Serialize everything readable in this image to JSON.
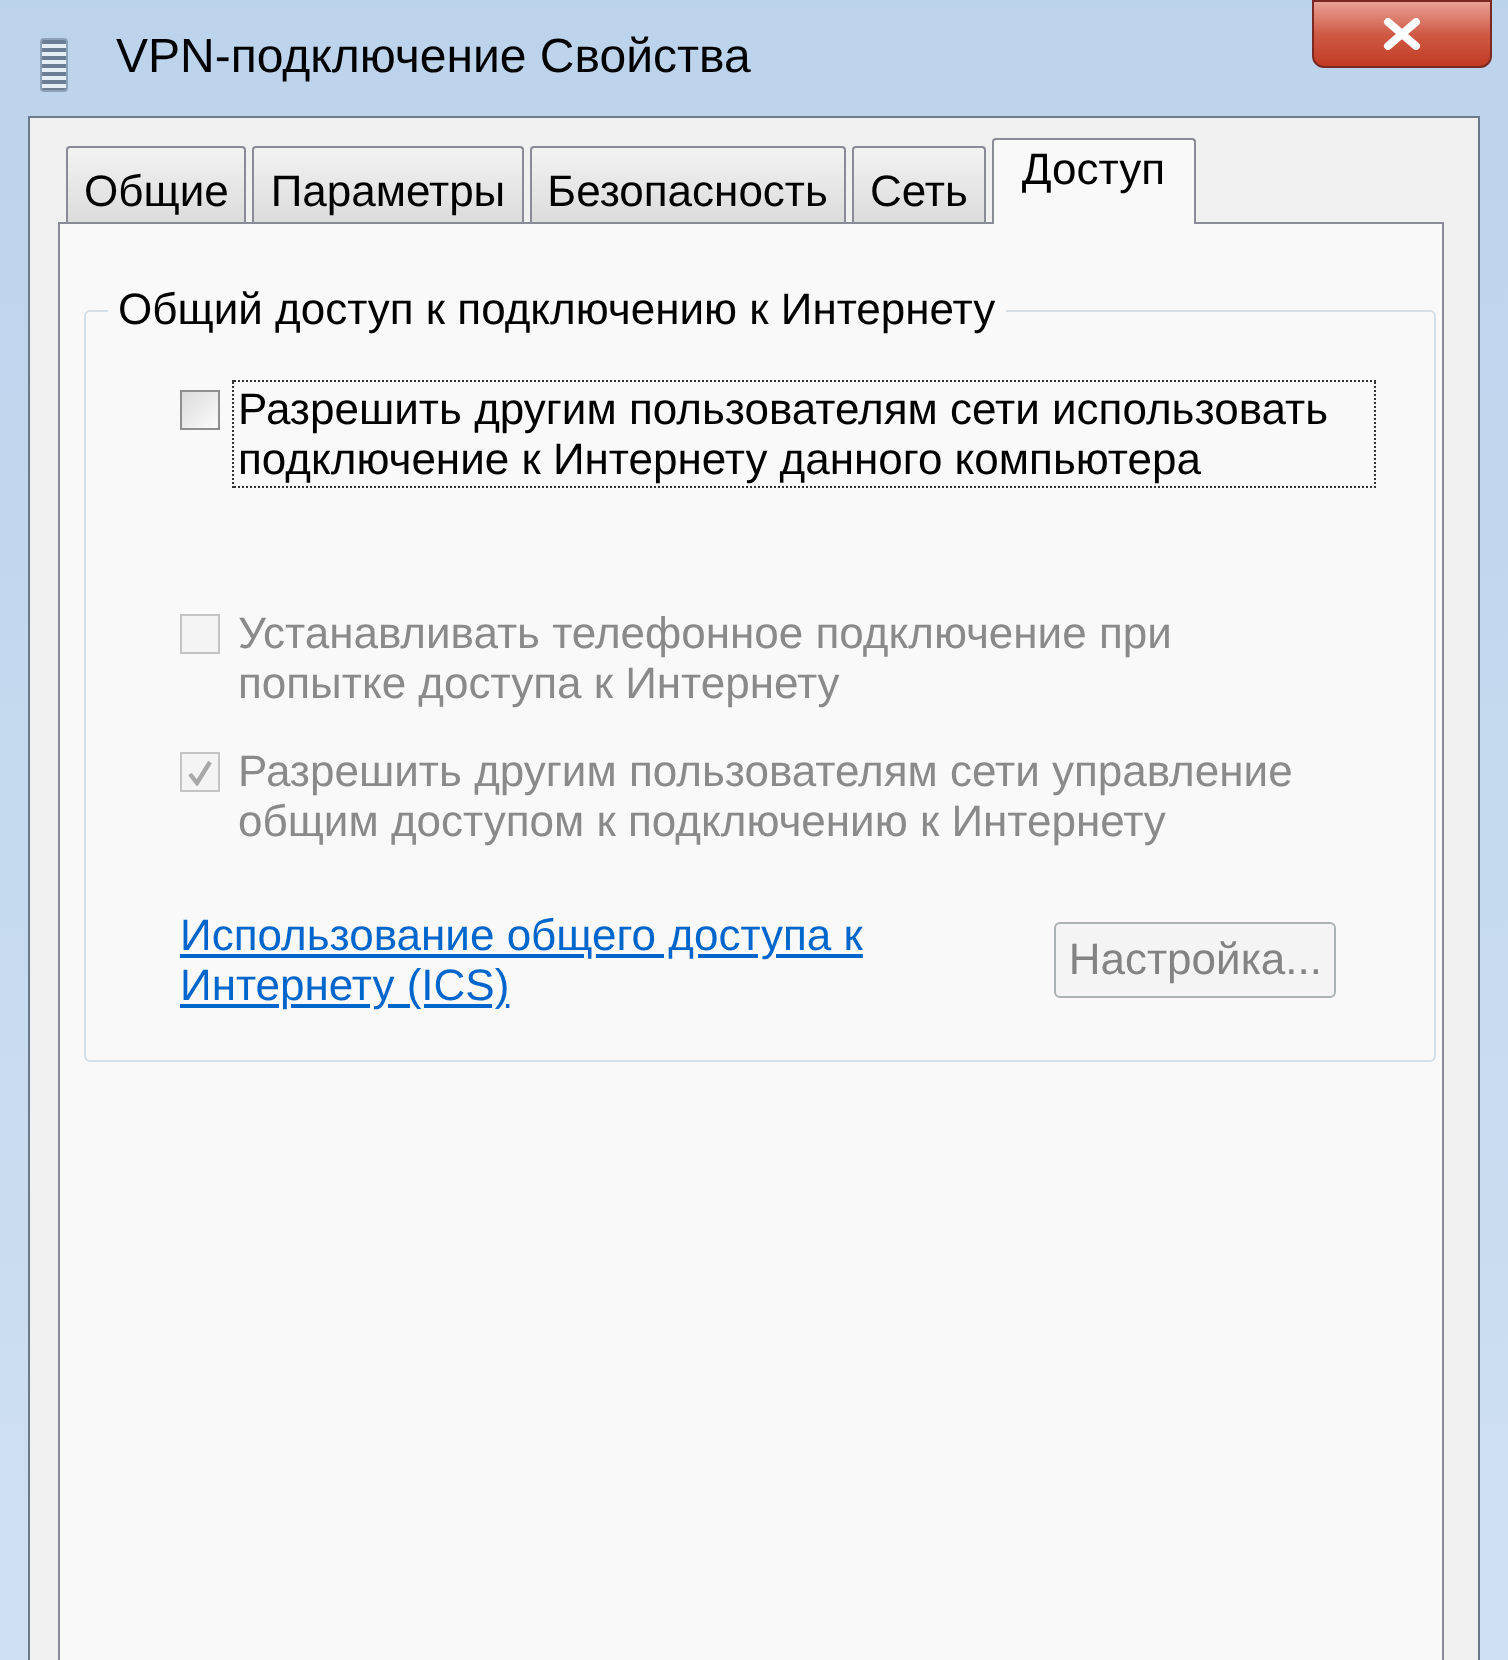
{
  "window": {
    "title": "VPN-подключение Свойства"
  },
  "tabs": [
    {
      "label": "Общие",
      "selected": false
    },
    {
      "label": "Параметры",
      "selected": false
    },
    {
      "label": "Безопасность",
      "selected": false
    },
    {
      "label": "Сеть",
      "selected": false
    },
    {
      "label": "Доступ",
      "selected": true
    }
  ],
  "group": {
    "title": "Общий доступ к подключению к Интернету",
    "options": [
      {
        "label": "Разрешить другим пользователям сети использовать подключение к Интернету данного компьютера",
        "checked": false,
        "disabled": false,
        "focused": true
      },
      {
        "label": "Устанавливать телефонное подключение при попытке доступа к Интернету",
        "checked": false,
        "disabled": true,
        "focused": false
      },
      {
        "label": "Разрешить другим пользователям сети управление общим доступом к подключению к Интернету",
        "checked": true,
        "disabled": true,
        "focused": false
      }
    ]
  },
  "link": "Использование общего доступа к Интернету (ICS)",
  "settings_button": {
    "label": "Настройка...",
    "disabled": true
  }
}
